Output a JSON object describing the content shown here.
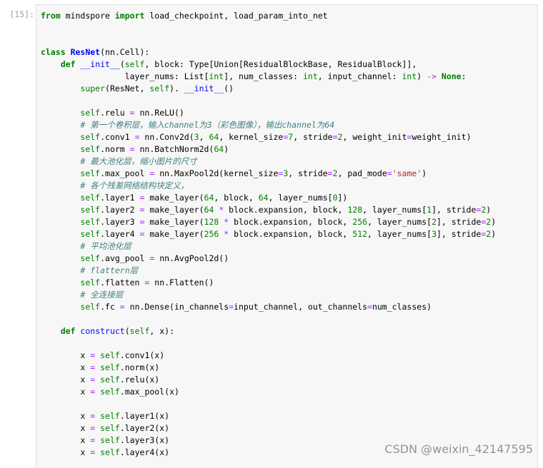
{
  "cell": {
    "prompt": "[15]:"
  },
  "watermark": "CSDN @weixin_42147595",
  "colors": {
    "keyword": "#008000",
    "class_name": "#0000ff",
    "function_name": "#0000ff",
    "builtin": "#008000",
    "operator": "#aa22ff",
    "number": "#008000",
    "string": "#ba2121",
    "comment": "#408080"
  },
  "code_lines": [
    [
      [
        "kw",
        "from"
      ],
      [
        "pl",
        " mindspore "
      ],
      [
        "kw",
        "import"
      ],
      [
        "pl",
        " load_checkpoint, load_param_into_net"
      ]
    ],
    [],
    [],
    [
      [
        "kw",
        "class"
      ],
      [
        "pl",
        " "
      ],
      [
        "cls",
        "ResNet"
      ],
      [
        "pl",
        "(nn.Cell):"
      ]
    ],
    [
      [
        "pl",
        "    "
      ],
      [
        "kw",
        "def"
      ],
      [
        "pl",
        " "
      ],
      [
        "fn",
        "__init__"
      ],
      [
        "pl",
        "("
      ],
      [
        "bi",
        "self"
      ],
      [
        "pl",
        ", block: Type[Union[ResidualBlockBase, ResidualBlock]],"
      ]
    ],
    [
      [
        "pl",
        "                 layer_nums: List["
      ],
      [
        "bi",
        "int"
      ],
      [
        "pl",
        "], num_classes: "
      ],
      [
        "bi",
        "int"
      ],
      [
        "pl",
        ", input_channel: "
      ],
      [
        "bi",
        "int"
      ],
      [
        "pl",
        ") "
      ],
      [
        "op",
        "->"
      ],
      [
        "pl",
        " "
      ],
      [
        "kw",
        "None"
      ],
      [
        "pl",
        ":"
      ]
    ],
    [
      [
        "pl",
        "        "
      ],
      [
        "bi",
        "super"
      ],
      [
        "pl",
        "(ResNet, "
      ],
      [
        "bi",
        "self"
      ],
      [
        "pl",
        "). "
      ],
      [
        "fn",
        "__init__"
      ],
      [
        "pl",
        "()"
      ]
    ],
    [],
    [
      [
        "pl",
        "        "
      ],
      [
        "bi",
        "self"
      ],
      [
        "pl",
        ".relu "
      ],
      [
        "op",
        "="
      ],
      [
        "pl",
        " nn.ReLU()"
      ]
    ],
    [
      [
        "pl",
        "        "
      ],
      [
        "cm",
        "# 第一个卷积层，输入channel为3（彩色图像），输出channel为64"
      ]
    ],
    [
      [
        "pl",
        "        "
      ],
      [
        "bi",
        "self"
      ],
      [
        "pl",
        ".conv1 "
      ],
      [
        "op",
        "="
      ],
      [
        "pl",
        " nn.Conv2d("
      ],
      [
        "num",
        "3"
      ],
      [
        "pl",
        ", "
      ],
      [
        "num",
        "64"
      ],
      [
        "pl",
        ", kernel_size"
      ],
      [
        "op",
        "="
      ],
      [
        "num",
        "7"
      ],
      [
        "pl",
        ", stride"
      ],
      [
        "op",
        "="
      ],
      [
        "num",
        "2"
      ],
      [
        "pl",
        ", weight_init"
      ],
      [
        "op",
        "="
      ],
      [
        "pl",
        "weight_init)"
      ]
    ],
    [
      [
        "pl",
        "        "
      ],
      [
        "bi",
        "self"
      ],
      [
        "pl",
        ".norm "
      ],
      [
        "op",
        "="
      ],
      [
        "pl",
        " nn.BatchNorm2d("
      ],
      [
        "num",
        "64"
      ],
      [
        "pl",
        ")"
      ]
    ],
    [
      [
        "pl",
        "        "
      ],
      [
        "cm",
        "# 最大池化层，缩小图片的尺寸"
      ]
    ],
    [
      [
        "pl",
        "        "
      ],
      [
        "bi",
        "self"
      ],
      [
        "pl",
        ".max_pool "
      ],
      [
        "op",
        "="
      ],
      [
        "pl",
        " nn.MaxPool2d(kernel_size"
      ],
      [
        "op",
        "="
      ],
      [
        "num",
        "3"
      ],
      [
        "pl",
        ", stride"
      ],
      [
        "op",
        "="
      ],
      [
        "num",
        "2"
      ],
      [
        "pl",
        ", pad_mode"
      ],
      [
        "op",
        "="
      ],
      [
        "str",
        "'same'"
      ],
      [
        "pl",
        ")"
      ]
    ],
    [
      [
        "pl",
        "        "
      ],
      [
        "cm",
        "# 各个残差网络结构块定义，"
      ]
    ],
    [
      [
        "pl",
        "        "
      ],
      [
        "bi",
        "self"
      ],
      [
        "pl",
        ".layer1 "
      ],
      [
        "op",
        "="
      ],
      [
        "pl",
        " make_layer("
      ],
      [
        "num",
        "64"
      ],
      [
        "pl",
        ", block, "
      ],
      [
        "num",
        "64"
      ],
      [
        "pl",
        ", layer_nums["
      ],
      [
        "num",
        "0"
      ],
      [
        "pl",
        "])"
      ]
    ],
    [
      [
        "pl",
        "        "
      ],
      [
        "bi",
        "self"
      ],
      [
        "pl",
        ".layer2 "
      ],
      [
        "op",
        "="
      ],
      [
        "pl",
        " make_layer("
      ],
      [
        "num",
        "64"
      ],
      [
        "pl",
        " "
      ],
      [
        "op",
        "*"
      ],
      [
        "pl",
        " block.expansion, block, "
      ],
      [
        "num",
        "128"
      ],
      [
        "pl",
        ", layer_nums["
      ],
      [
        "num",
        "1"
      ],
      [
        "pl",
        "], stride"
      ],
      [
        "op",
        "="
      ],
      [
        "num",
        "2"
      ],
      [
        "pl",
        ")"
      ]
    ],
    [
      [
        "pl",
        "        "
      ],
      [
        "bi",
        "self"
      ],
      [
        "pl",
        ".layer3 "
      ],
      [
        "op",
        "="
      ],
      [
        "pl",
        " make_layer("
      ],
      [
        "num",
        "128"
      ],
      [
        "pl",
        " "
      ],
      [
        "op",
        "*"
      ],
      [
        "pl",
        " block.expansion, block, "
      ],
      [
        "num",
        "256"
      ],
      [
        "pl",
        ", layer_nums["
      ],
      [
        "num",
        "2"
      ],
      [
        "pl",
        "], stride"
      ],
      [
        "op",
        "="
      ],
      [
        "num",
        "2"
      ],
      [
        "pl",
        ")"
      ]
    ],
    [
      [
        "pl",
        "        "
      ],
      [
        "bi",
        "self"
      ],
      [
        "pl",
        ".layer4 "
      ],
      [
        "op",
        "="
      ],
      [
        "pl",
        " make_layer("
      ],
      [
        "num",
        "256"
      ],
      [
        "pl",
        " "
      ],
      [
        "op",
        "*"
      ],
      [
        "pl",
        " block.expansion, block, "
      ],
      [
        "num",
        "512"
      ],
      [
        "pl",
        ", layer_nums["
      ],
      [
        "num",
        "3"
      ],
      [
        "pl",
        "], stride"
      ],
      [
        "op",
        "="
      ],
      [
        "num",
        "2"
      ],
      [
        "pl",
        ")"
      ]
    ],
    [
      [
        "pl",
        "        "
      ],
      [
        "cm",
        "# 平均池化层"
      ]
    ],
    [
      [
        "pl",
        "        "
      ],
      [
        "bi",
        "self"
      ],
      [
        "pl",
        ".avg_pool "
      ],
      [
        "op",
        "="
      ],
      [
        "pl",
        " nn.AvgPool2d()"
      ]
    ],
    [
      [
        "pl",
        "        "
      ],
      [
        "cm",
        "# flattern层"
      ]
    ],
    [
      [
        "pl",
        "        "
      ],
      [
        "bi",
        "self"
      ],
      [
        "pl",
        ".flatten "
      ],
      [
        "op",
        "="
      ],
      [
        "pl",
        " nn.Flatten()"
      ]
    ],
    [
      [
        "pl",
        "        "
      ],
      [
        "cm",
        "# 全连接层"
      ]
    ],
    [
      [
        "pl",
        "        "
      ],
      [
        "bi",
        "self"
      ],
      [
        "pl",
        ".fc "
      ],
      [
        "op",
        "="
      ],
      [
        "pl",
        " nn.Dense(in_channels"
      ],
      [
        "op",
        "="
      ],
      [
        "pl",
        "input_channel, out_channels"
      ],
      [
        "op",
        "="
      ],
      [
        "pl",
        "num_classes)"
      ]
    ],
    [],
    [
      [
        "pl",
        "    "
      ],
      [
        "kw",
        "def"
      ],
      [
        "pl",
        " "
      ],
      [
        "fn",
        "construct"
      ],
      [
        "pl",
        "("
      ],
      [
        "bi",
        "self"
      ],
      [
        "pl",
        ", x):"
      ]
    ],
    [],
    [
      [
        "pl",
        "        x "
      ],
      [
        "op",
        "="
      ],
      [
        "pl",
        " "
      ],
      [
        "bi",
        "self"
      ],
      [
        "pl",
        ".conv1(x)"
      ]
    ],
    [
      [
        "pl",
        "        x "
      ],
      [
        "op",
        "="
      ],
      [
        "pl",
        " "
      ],
      [
        "bi",
        "self"
      ],
      [
        "pl",
        ".norm(x)"
      ]
    ],
    [
      [
        "pl",
        "        x "
      ],
      [
        "op",
        "="
      ],
      [
        "pl",
        " "
      ],
      [
        "bi",
        "self"
      ],
      [
        "pl",
        ".relu(x)"
      ]
    ],
    [
      [
        "pl",
        "        x "
      ],
      [
        "op",
        "="
      ],
      [
        "pl",
        " "
      ],
      [
        "bi",
        "self"
      ],
      [
        "pl",
        ".max_pool(x)"
      ]
    ],
    [],
    [
      [
        "pl",
        "        x "
      ],
      [
        "op",
        "="
      ],
      [
        "pl",
        " "
      ],
      [
        "bi",
        "self"
      ],
      [
        "pl",
        ".layer1(x)"
      ]
    ],
    [
      [
        "pl",
        "        x "
      ],
      [
        "op",
        "="
      ],
      [
        "pl",
        " "
      ],
      [
        "bi",
        "self"
      ],
      [
        "pl",
        ".layer2(x)"
      ]
    ],
    [
      [
        "pl",
        "        x "
      ],
      [
        "op",
        "="
      ],
      [
        "pl",
        " "
      ],
      [
        "bi",
        "self"
      ],
      [
        "pl",
        ".layer3(x)"
      ]
    ],
    [
      [
        "pl",
        "        x "
      ],
      [
        "op",
        "="
      ],
      [
        "pl",
        " "
      ],
      [
        "bi",
        "self"
      ],
      [
        "pl",
        ".layer4(x)"
      ]
    ]
  ]
}
